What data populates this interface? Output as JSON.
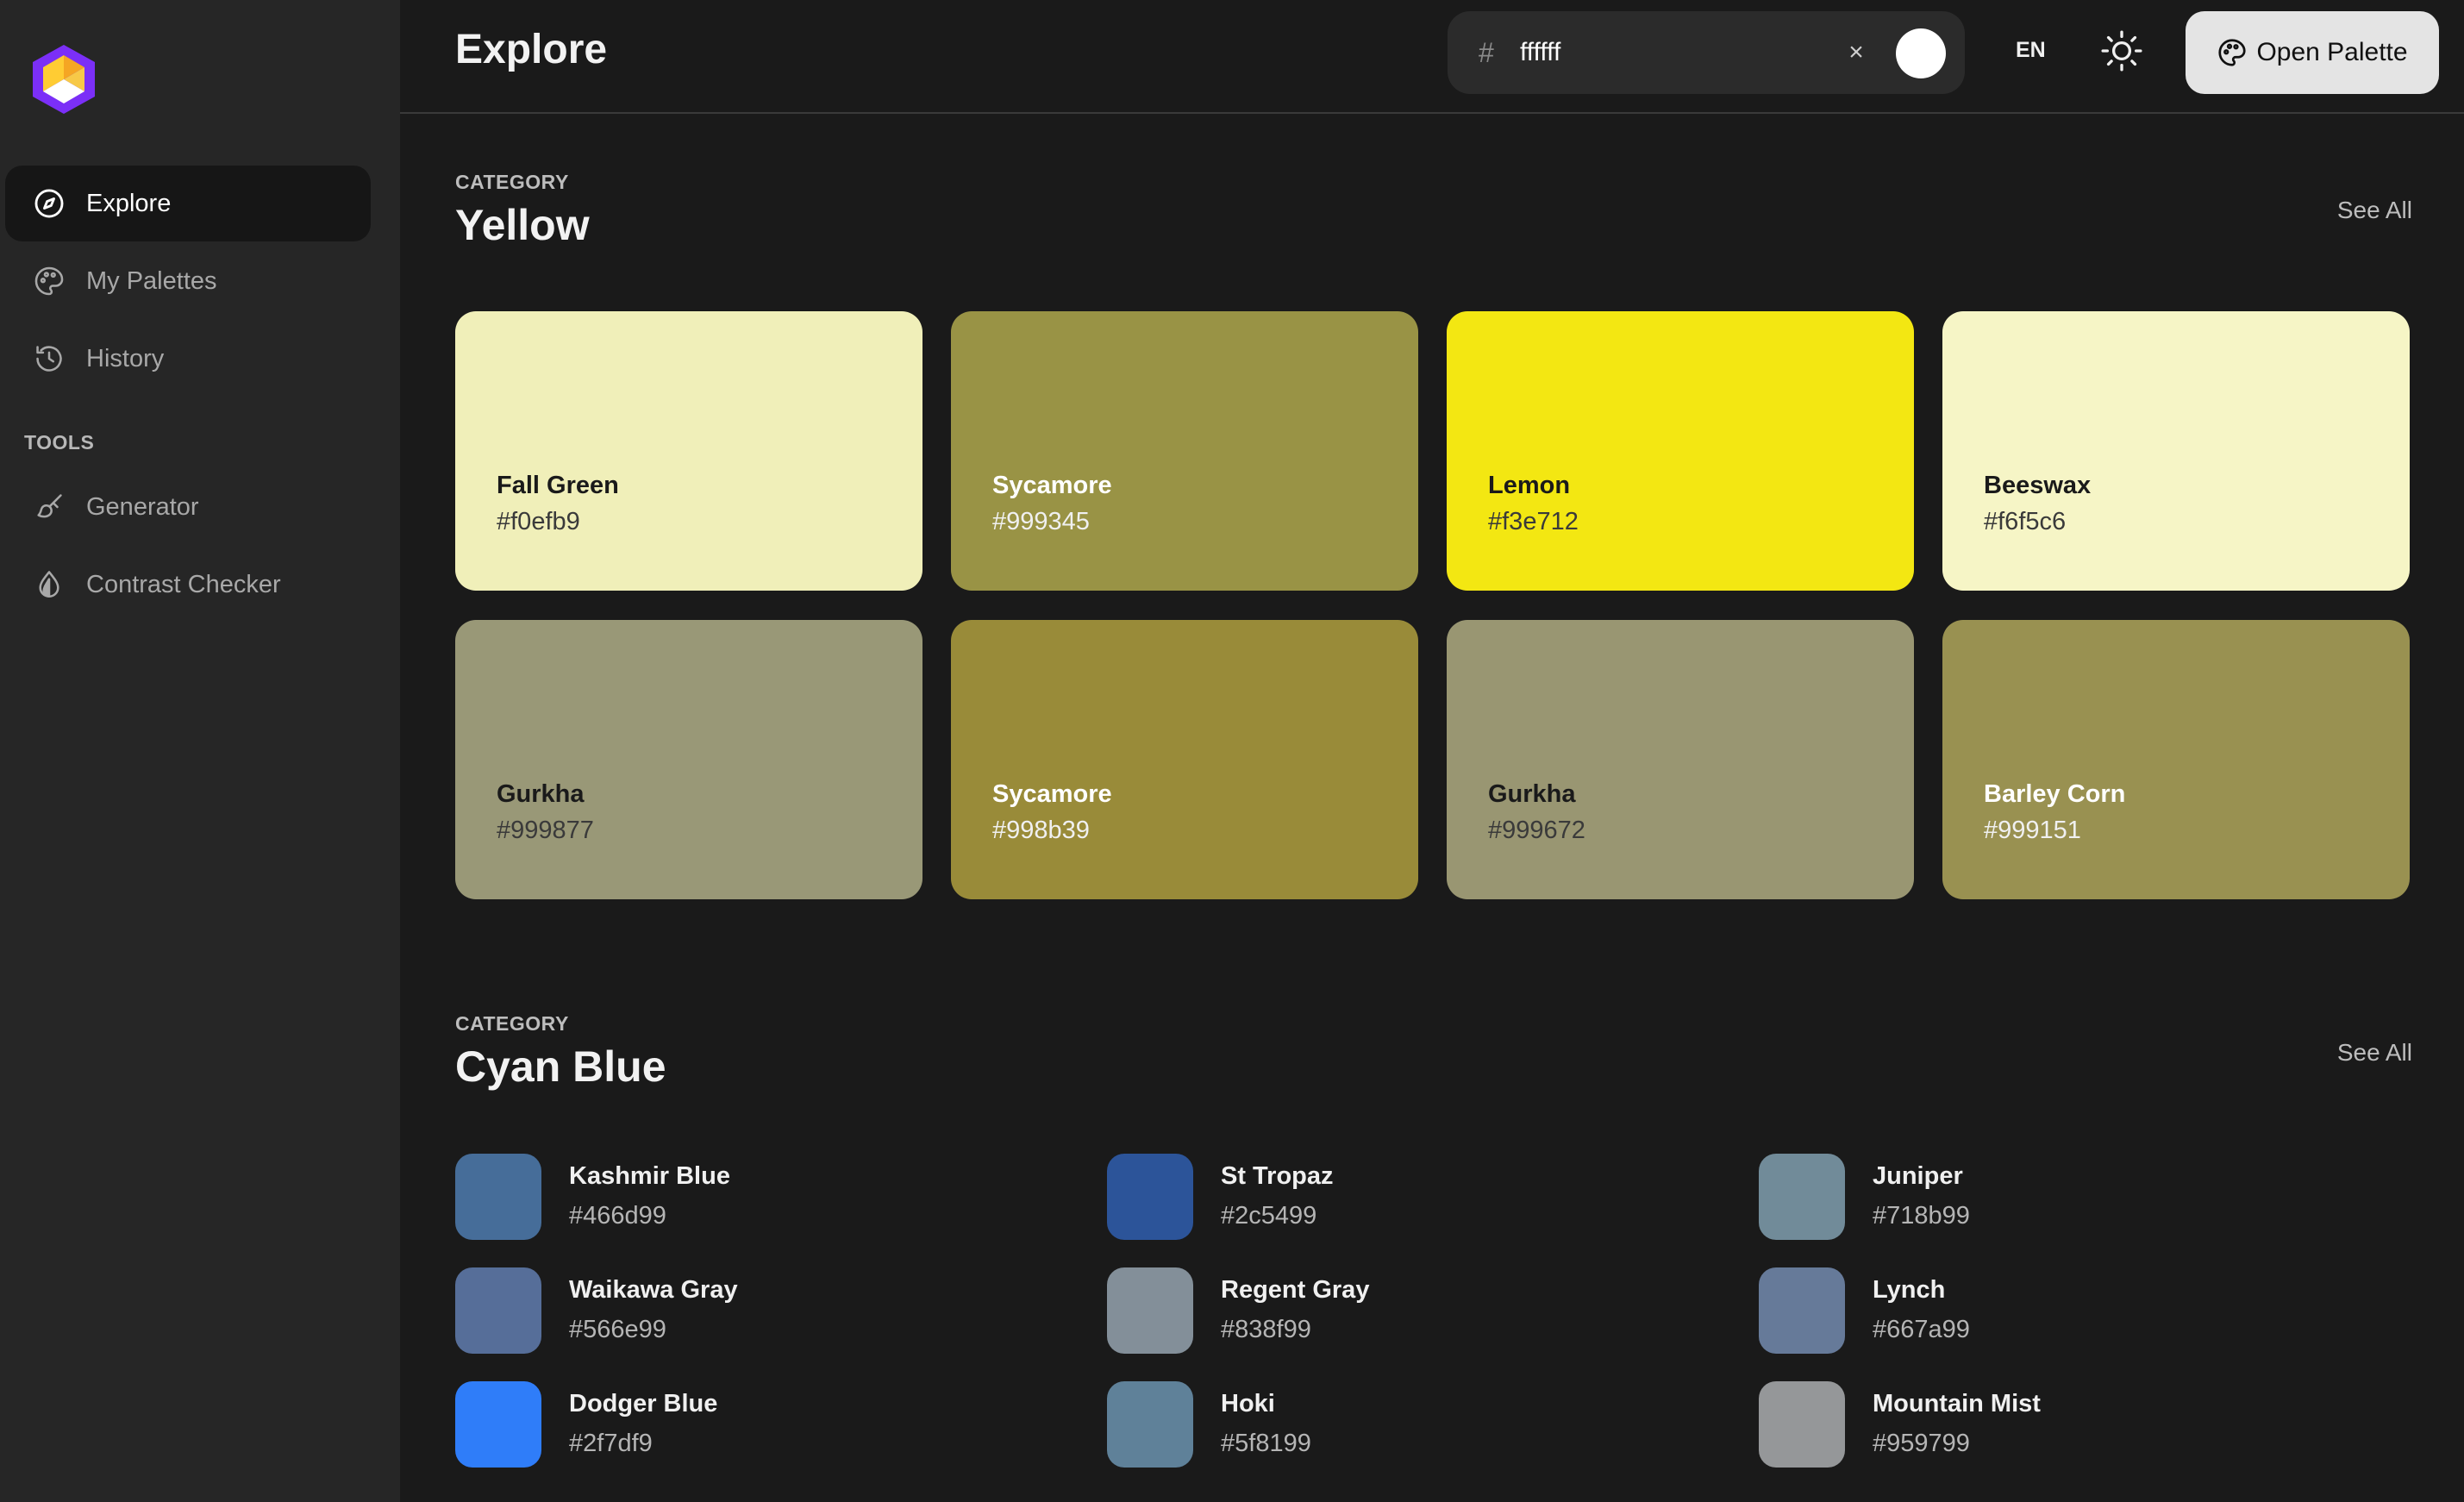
{
  "sidebar": {
    "items": [
      {
        "label": "Explore",
        "icon": "compass-icon"
      },
      {
        "label": "My Palettes",
        "icon": "palette-icon"
      },
      {
        "label": "History",
        "icon": "history-icon"
      }
    ],
    "tools_label": "TOOLS",
    "tools": [
      {
        "label": "Generator",
        "icon": "brush-icon"
      },
      {
        "label": "Contrast Checker",
        "icon": "drop-icon"
      }
    ]
  },
  "header": {
    "title": "Explore",
    "search": {
      "prefix": "#",
      "value": "ffffff",
      "clear": "×",
      "swatch_color": "#ffffff"
    },
    "lang": "EN",
    "open_palette": "Open Palette"
  },
  "sections": [
    {
      "label": "CATEGORY",
      "title": "Yellow",
      "see_all": "See All",
      "cards": [
        {
          "name": "Fall Green",
          "hex": "#f0efb9",
          "color": "#f0efb9",
          "text": "dark"
        },
        {
          "name": "Sycamore",
          "hex": "#999345",
          "color": "#999345",
          "text": "light"
        },
        {
          "name": "Lemon",
          "hex": "#f3e712",
          "color": "#f3e712",
          "text": "dark"
        },
        {
          "name": "Beeswax",
          "hex": "#f6f5c6",
          "color": "#f6f5c6",
          "text": "dark"
        },
        {
          "name": "Gurkha",
          "hex": "#999877",
          "color": "#999877",
          "text": "dark"
        },
        {
          "name": "Sycamore",
          "hex": "#998b39",
          "color": "#998b39",
          "text": "light"
        },
        {
          "name": "Gurkha",
          "hex": "#999672",
          "color": "#999672",
          "text": "dark"
        },
        {
          "name": "Barley Corn",
          "hex": "#999151",
          "color": "#999151",
          "text": "light"
        }
      ]
    },
    {
      "label": "CATEGORY",
      "title": "Cyan Blue",
      "see_all": "See All",
      "items": [
        {
          "name": "Kashmir Blue",
          "hex": "#466d99",
          "color": "#466d99"
        },
        {
          "name": "St Tropaz",
          "hex": "#2c5499",
          "color": "#2c5499"
        },
        {
          "name": "Juniper",
          "hex": "#718b99",
          "color": "#718b99"
        },
        {
          "name": "Waikawa Gray",
          "hex": "#566e99",
          "color": "#566e99"
        },
        {
          "name": "Regent Gray",
          "hex": "#838f99",
          "color": "#838f99"
        },
        {
          "name": "Lynch",
          "hex": "#667a99",
          "color": "#667a99"
        },
        {
          "name": "Dodger Blue",
          "hex": "#2f7df9",
          "color": "#2f7df9"
        },
        {
          "name": "Hoki",
          "hex": "#5f8199",
          "color": "#5f8199"
        },
        {
          "name": "Mountain Mist",
          "hex": "#959799",
          "color": "#959799"
        }
      ]
    }
  ]
}
